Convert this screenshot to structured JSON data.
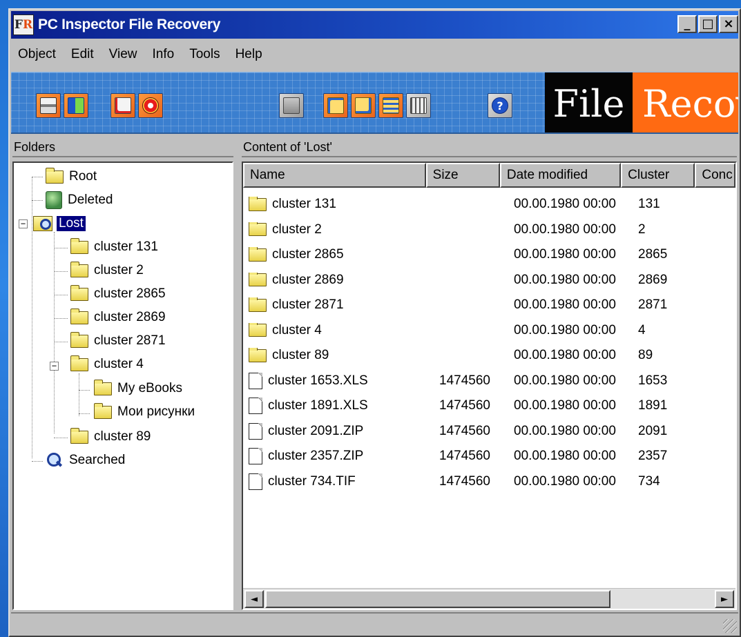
{
  "window": {
    "title": "PC Inspector File Recovery",
    "logo_f": "F",
    "logo_r": "R",
    "controls": {
      "minimize": "_",
      "maximize": "□",
      "close": "×"
    }
  },
  "menu": [
    {
      "label": "Object"
    },
    {
      "label": "Edit"
    },
    {
      "label": "View"
    },
    {
      "label": "Info"
    },
    {
      "label": "Tools"
    },
    {
      "label": "Help"
    }
  ],
  "toolbar": {
    "buttons": [
      {
        "icon": "drive-icon"
      },
      {
        "icon": "save-icon"
      },
      {
        "icon": "check-icon"
      },
      {
        "icon": "lifebuoy-icon"
      },
      {
        "icon": "folder-icon"
      },
      {
        "icon": "large-icons-icon"
      },
      {
        "icon": "small-icons-icon"
      },
      {
        "icon": "list-view-icon"
      },
      {
        "icon": "details-view-icon"
      },
      {
        "icon": "help-icon"
      }
    ],
    "banner_black": "File",
    "banner_orange": "Recov"
  },
  "folders": {
    "header": "Folders",
    "nodes": {
      "root": "Root",
      "deleted": "Deleted",
      "lost": "Lost",
      "c131": "cluster 131",
      "c2": "cluster 2",
      "c2865": "cluster 2865",
      "c2869": "cluster 2869",
      "c2871": "cluster 2871",
      "c4": "cluster 4",
      "ebooks": "My eBooks",
      "pictures": "Мои рисунки",
      "c89": "cluster 89",
      "searched": "Searched"
    },
    "expand_minus": "−"
  },
  "content": {
    "header": "Content of 'Lost'",
    "columns": [
      "Name",
      "Size",
      "Date modified",
      "Cluster",
      "Conc"
    ],
    "rows": [
      {
        "type": "folder",
        "name": "cluster 131",
        "size": "",
        "date": "00.00.1980 00:00",
        "cluster": "131"
      },
      {
        "type": "folder",
        "name": "cluster 2",
        "size": "",
        "date": "00.00.1980 00:00",
        "cluster": "2"
      },
      {
        "type": "folder",
        "name": "cluster 2865",
        "size": "",
        "date": "00.00.1980 00:00",
        "cluster": "2865"
      },
      {
        "type": "folder",
        "name": "cluster 2869",
        "size": "",
        "date": "00.00.1980 00:00",
        "cluster": "2869"
      },
      {
        "type": "folder",
        "name": "cluster 2871",
        "size": "",
        "date": "00.00.1980 00:00",
        "cluster": "2871"
      },
      {
        "type": "folder",
        "name": "cluster 4",
        "size": "",
        "date": "00.00.1980 00:00",
        "cluster": "4"
      },
      {
        "type": "folder",
        "name": "cluster 89",
        "size": "",
        "date": "00.00.1980 00:00",
        "cluster": "89"
      },
      {
        "type": "file",
        "name": "cluster 1653.XLS",
        "size": "1474560",
        "date": "00.00.1980 00:00",
        "cluster": "1653"
      },
      {
        "type": "file",
        "name": "cluster 1891.XLS",
        "size": "1474560",
        "date": "00.00.1980 00:00",
        "cluster": "1891"
      },
      {
        "type": "file",
        "name": "cluster 2091.ZIP",
        "size": "1474560",
        "date": "00.00.1980 00:00",
        "cluster": "2091"
      },
      {
        "type": "file",
        "name": "cluster 2357.ZIP",
        "size": "1474560",
        "date": "00.00.1980 00:00",
        "cluster": "2357"
      },
      {
        "type": "file",
        "name": "cluster 734.TIF",
        "size": "1474560",
        "date": "00.00.1980 00:00",
        "cluster": "734"
      }
    ],
    "scroll_left": "◄",
    "scroll_right": "►"
  },
  "colors": {
    "titlebar_start": "#0a1e8c",
    "toolbar_blue": "#3b7fcf",
    "tool_orange": "#e8641c",
    "banner_orange": "#ff6a12",
    "selection": "#000080"
  }
}
